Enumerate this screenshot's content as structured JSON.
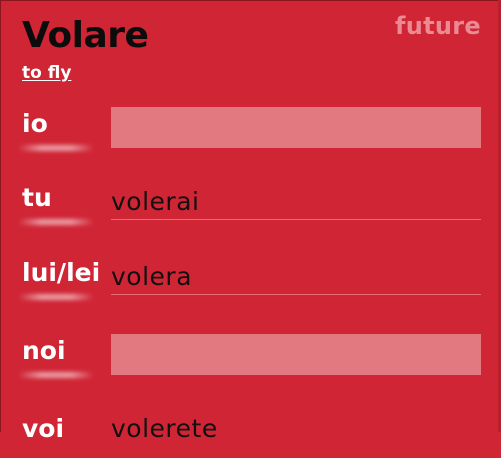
{
  "card": {
    "tense": "future",
    "verb": "Volare",
    "translation": "to fly"
  },
  "rows": [
    {
      "pronoun": "io",
      "answer": "",
      "input_empty": true
    },
    {
      "pronoun": "tu",
      "answer": "volerai",
      "input_empty": false
    },
    {
      "pronoun": "lui/lei",
      "answer": "volera",
      "input_empty": false
    },
    {
      "pronoun": "noi",
      "answer": "",
      "input_empty": true
    },
    {
      "pronoun": "voi",
      "answer": "volerete",
      "input_empty": false
    }
  ],
  "colors": {
    "card_background": "#d02535",
    "input_fill": "#e27880",
    "tense_label": "#ea8a93"
  }
}
